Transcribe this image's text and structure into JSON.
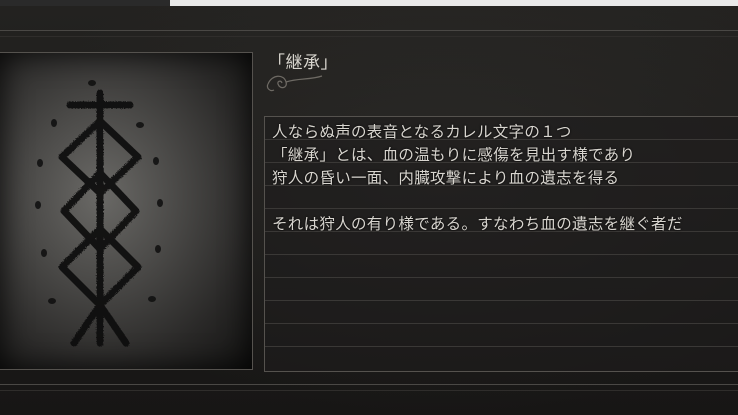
{
  "item": {
    "name": "「継承」",
    "description_lines": [
      "人ならぬ声の表音となるカレル文字の１つ",
      "「継承」とは、血の温もりに感傷を見出す様であり",
      "狩人の昏い一面、内臓攻撃により血の遺志を得る",
      "",
      "それは狩人の有り様である。すなわち血の遺志を継ぐ者だ"
    ]
  },
  "icons": {
    "rune": "caryll-rune-inherit-icon",
    "ornament": "title-flourish-ornament"
  },
  "colors": {
    "text": "#d8d5cf",
    "background": "#1c1b1a",
    "border": "#55524e"
  }
}
